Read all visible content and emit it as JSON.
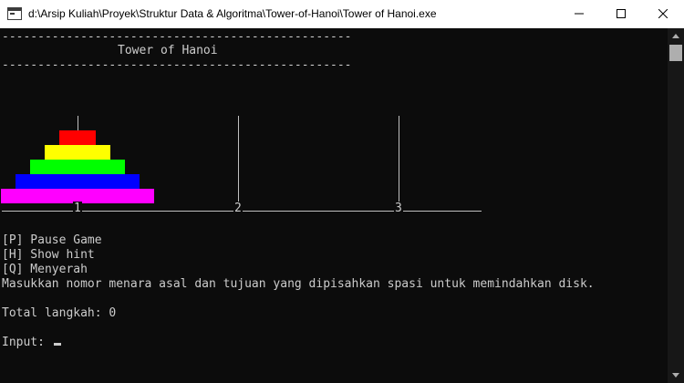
{
  "window": {
    "title": "d:\\Arsip Kuliah\\Proyek\\Struktur Data & Algoritma\\Tower-of-Hanoi\\Tower of Hanoi.exe",
    "minimize_icon": "minimize-icon",
    "maximize_icon": "maximize-icon",
    "close_icon": "close-icon"
  },
  "console": {
    "rule_line": "-------------------------------------------------",
    "header_title": "Tower of Hanoi",
    "towers": [
      {
        "label": "1",
        "disks": 5
      },
      {
        "label": "2",
        "disks": 0
      },
      {
        "label": "3",
        "disks": 0
      }
    ],
    "disk_colors": [
      "#ff0000",
      "#ffff00",
      "#00ff00",
      "#0000ff",
      "#ff00ff"
    ],
    "menu": {
      "pause": "[P] Pause Game",
      "hint": "[H] Show hint",
      "quit": "[Q] Menyerah"
    },
    "instruction": "Masukkan nomor menara asal dan tujuan yang dipisahkan spasi untuk memindahkan disk.",
    "moves": "Total langkah: 0",
    "input_label": "Input: "
  }
}
